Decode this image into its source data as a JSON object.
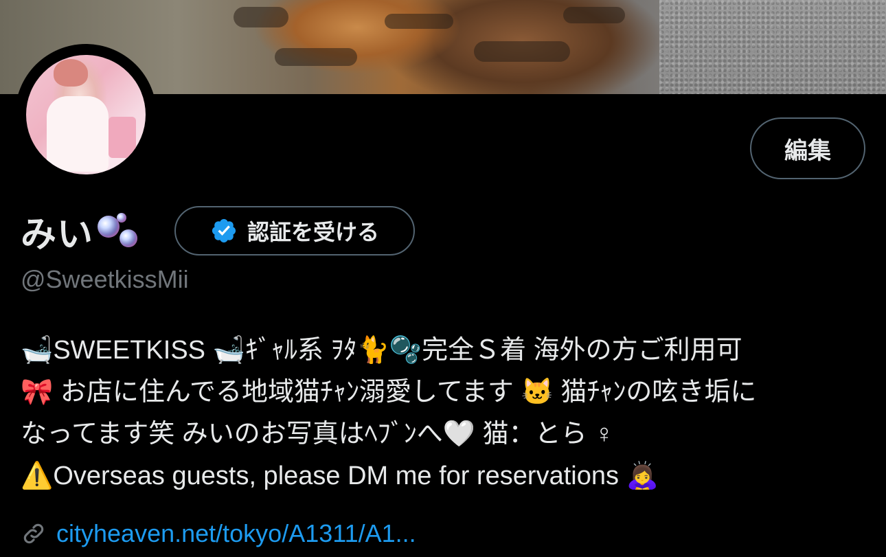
{
  "profile": {
    "display_name": "みい🫧",
    "display_name_text": "みい",
    "handle": "@SweetkissMii",
    "edit_label": "編集",
    "verify_label": "認証を受ける",
    "bio_lines": [
      "🛁SWEETKISS 🛁ｷﾞｬﾙ系 ｦﾀ🐈🫧完全Ｓ着 海外の方ご利用可",
      "🎀 お店に住んでる地域猫ﾁｬﾝ溺愛してます 🐱 猫ﾁｬﾝの呟き垢に",
      "なってます笑 みいのお写真はﾍﾌﾞﾝへ🤍 猫：とら ♀",
      "⚠️Overseas guests, please DM me for reservations 🙇‍♀️"
    ],
    "link_text": "cityheaven.net/tokyo/A1311/A1...",
    "accent_color": "#1d9bf0",
    "icons": {
      "verify": "verified-badge-icon",
      "link": "link-icon",
      "name_emoji": "bubbles-icon"
    }
  }
}
